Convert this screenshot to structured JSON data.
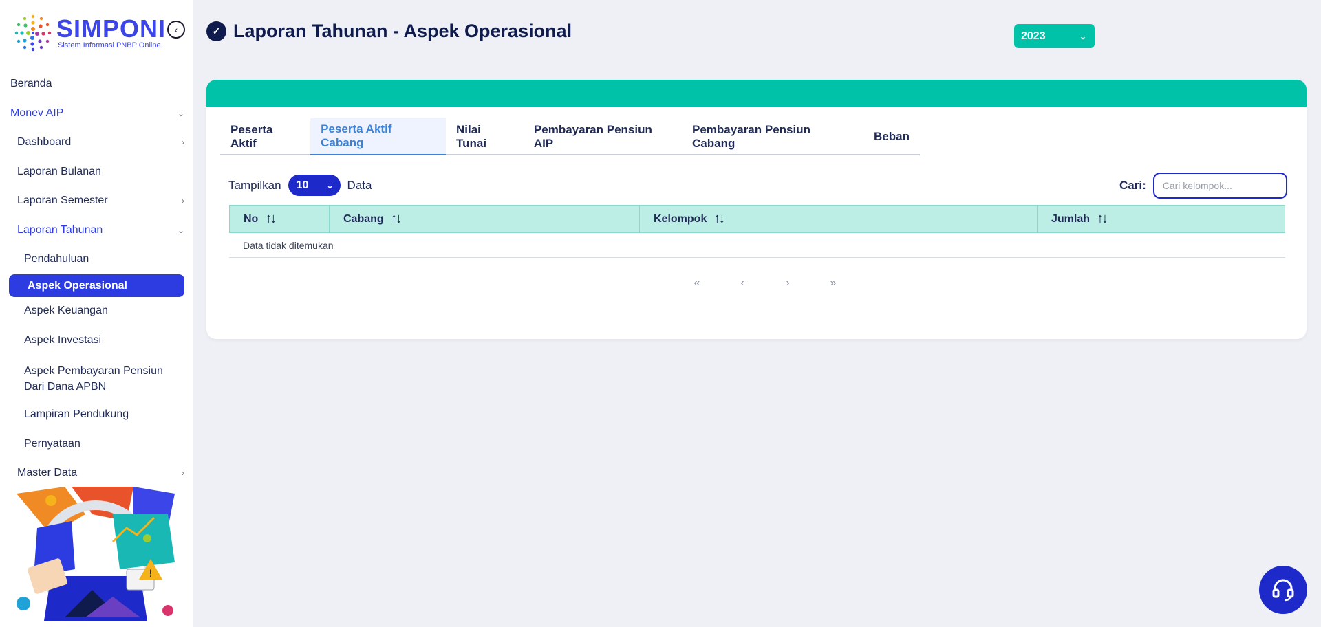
{
  "app": {
    "title": "SIMPONI",
    "subtitle": "Sistem Informasi PNBP Online"
  },
  "sidebar": {
    "items": [
      {
        "label": "Beranda"
      },
      {
        "label": "Monev AIP"
      },
      {
        "label": "Dashboard"
      },
      {
        "label": "Laporan Bulanan"
      },
      {
        "label": "Laporan Semester"
      },
      {
        "label": "Laporan Tahunan"
      },
      {
        "label": "Pendahuluan"
      },
      {
        "label": "Aspek Operasional"
      },
      {
        "label": "Aspek Keuangan"
      },
      {
        "label": "Aspek Investasi"
      },
      {
        "label": "Aspek Pembayaran Pensiun Dari Dana APBN"
      },
      {
        "label": "Lampiran Pendukung"
      },
      {
        "label": "Pernyataan"
      },
      {
        "label": "Master Data"
      }
    ]
  },
  "header": {
    "title": "Laporan Tahunan - Aspek Operasional",
    "year": "2023"
  },
  "tabs": [
    {
      "label": "Peserta Aktif"
    },
    {
      "label": "Peserta Aktif Cabang"
    },
    {
      "label": "Nilai Tunai"
    },
    {
      "label": "Pembayaran Pensiun AIP"
    },
    {
      "label": "Pembayaran Pensiun Cabang"
    },
    {
      "label": "Beban"
    }
  ],
  "table_controls": {
    "show_label": "Tampilkan",
    "page_size": "10",
    "data_label": "Data",
    "search_label": "Cari:",
    "search_placeholder": "Cari kelompok..."
  },
  "table": {
    "columns": [
      "No",
      "Cabang",
      "Kelompok",
      "Jumlah"
    ],
    "empty_text": "Data tidak ditemukan"
  },
  "pager": {
    "first": "«",
    "prev": "‹",
    "next": "›",
    "last": "»"
  },
  "colors": {
    "brand": "#2d3ce0",
    "accent": "#00c2a8",
    "header_bg": "#bdeee6"
  }
}
